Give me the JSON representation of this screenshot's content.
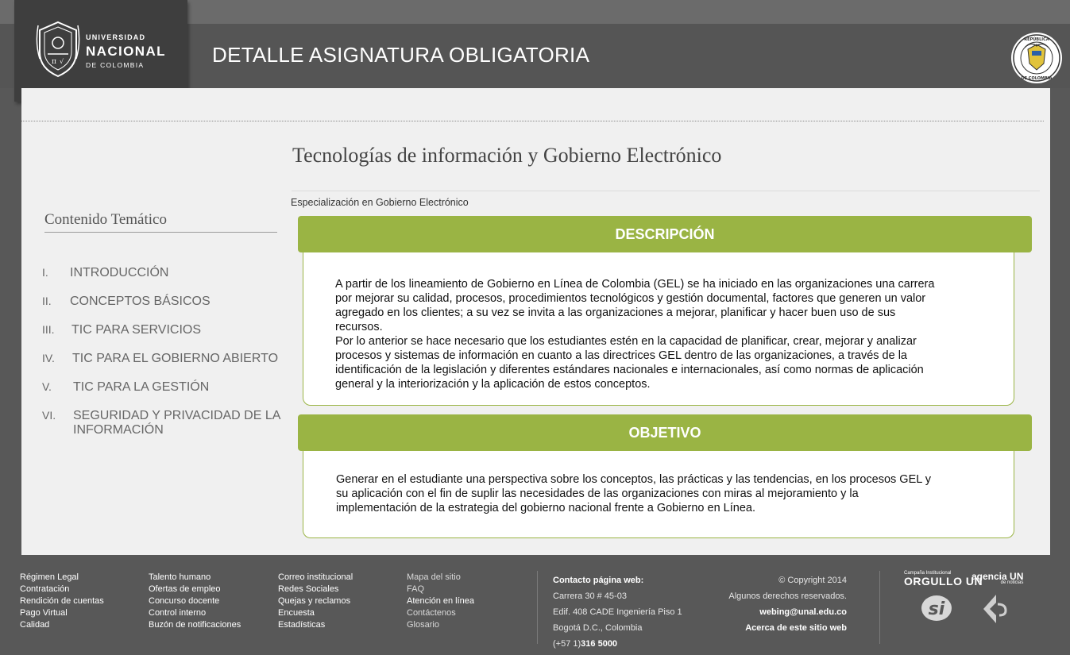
{
  "header": {
    "logo_line1": "UNIVERSIDAD",
    "logo_line2": "NACIONAL",
    "logo_line3": "DE COLOMBIA",
    "page_title": "DETALLE ASIGNATURA OBLIGATORIA",
    "seal_top": "REPÚBLICA",
    "seal_bottom": "DE COLOMBIA"
  },
  "course": {
    "title": "Tecnologías de información y Gobierno Electrónico",
    "program": "Especialización en Gobierno Electrónico"
  },
  "sidebar": {
    "title": "Contenido Temático",
    "topics": [
      {
        "num": "I.",
        "label": "INTRODUCCIÓN"
      },
      {
        "num": "II.",
        "label": "CONCEPTOS BÁSICOS"
      },
      {
        "num": "III.",
        "label": "TIC PARA SERVICIOS"
      },
      {
        "num": "IV.",
        "label": "TIC PARA EL GOBIERNO ABIERTO"
      },
      {
        "num": "V.",
        "label": "TIC PARA LA GESTIÓN"
      },
      {
        "num": "VI.",
        "label": "SEGURIDAD Y PRIVACIDAD DE LA",
        "label2": "INFORMACIÓN"
      }
    ]
  },
  "descripcion": {
    "heading": "DESCRIPCIÓN",
    "lines": [
      "A partir de los lineamiento de Gobierno en Línea de Colombia (GEL) se ha iniciado en las organizaciones una carrera",
      "por mejorar su calidad, procesos, procedimientos tecnológicos y gestión documental, factores que generen un valor",
      "agregado en los clientes; a su vez se invita a las organizaciones a mejorar, planificar y hacer buen uso de sus",
      "recursos.",
      "Por lo anterior se hace necesario que los estudiantes estén en la capacidad de planificar, crear, mejorar y analizar",
      "procesos y sistemas de información en cuanto a las directrices GEL dentro de las organizaciones, a través de la",
      "identificación de la legislación y diferentes estándares nacionales e internacionales, así como normas de aplicación",
      "general y la interiorización y la aplicación de estos conceptos."
    ]
  },
  "objetivo": {
    "heading": "OBJETIVO",
    "lines": [
      "Generar en el estudiante una perspectiva sobre los conceptos, las prácticas y las tendencias, en los procesos GEL y",
      "su aplicación con el fin de suplir las necesidades de las organizaciones con miras al mejoramiento y la",
      "implementación de la estrategia del gobierno nacional frente a Gobierno en Línea."
    ]
  },
  "footer": {
    "col1": [
      "Régimen Legal",
      "Contratación",
      "Rendición de cuentas",
      "Pago Virtual",
      "Calidad"
    ],
    "col2": [
      "Talento humano",
      "Ofertas de empleo",
      "Concurso docente",
      "Control interno",
      "Buzón de notificaciones"
    ],
    "col3": [
      "Correo institucional",
      "Redes Sociales",
      "Quejas y reclamos",
      "Encuesta",
      "Estadísticas"
    ],
    "col4": [
      "Mapa del sitio",
      "FAQ",
      "Atención en línea",
      "Contáctenos",
      "Glosario"
    ],
    "contact_title": "Contacto página web:",
    "contact_lines": [
      "Carrera 30 # 45-03",
      "Edif. 408 CADE Ingeniería Piso 1",
      "Bogotá D.C., Colombia"
    ],
    "phone_prefix": "(+57 1)",
    "phone_number": "316 5000",
    "copyright": "© Copyright 2014",
    "rights": "Algunos derechos reservados.",
    "email": "webing@unal.edu.co",
    "about": "Acerca de este sitio web",
    "orgullo_small": "Campaña Institucional",
    "orgullo_big": "ORGULLO UN",
    "agencia_big": "agencia UN",
    "agencia_small": "de noticias"
  }
}
